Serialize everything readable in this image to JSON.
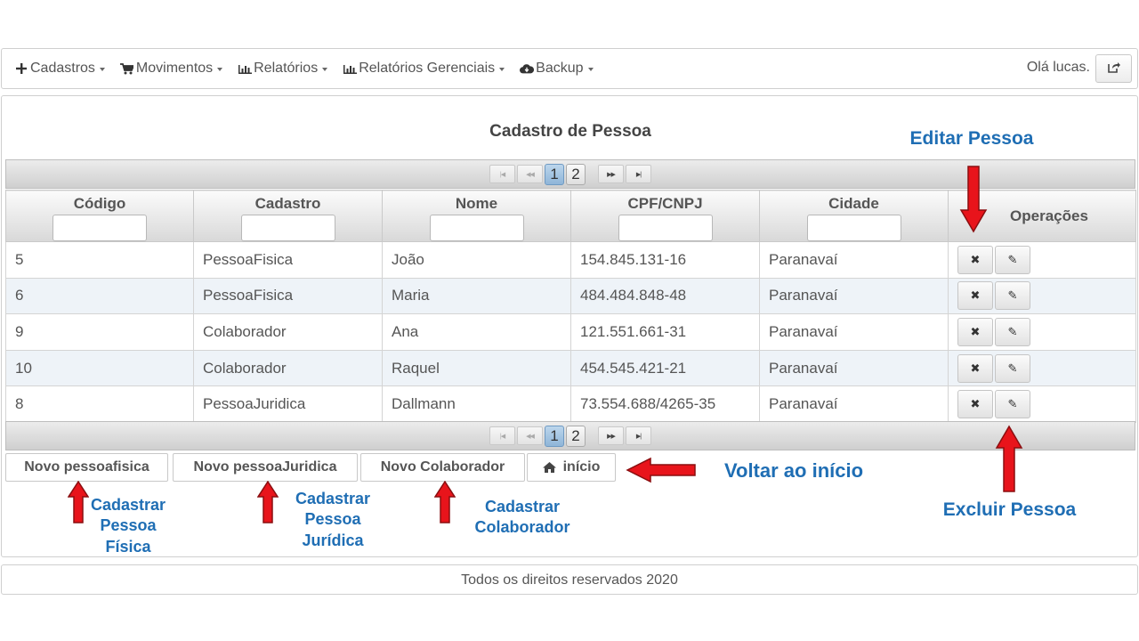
{
  "navbar": {
    "menus": [
      {
        "icon": "plus-icon",
        "label": "Cadastros"
      },
      {
        "icon": "cart-icon",
        "label": "Movimentos"
      },
      {
        "icon": "bar-chart-icon",
        "label": "Relatórios"
      },
      {
        "icon": "bar-chart-icon",
        "label": "Relatórios Gerenciais"
      },
      {
        "icon": "cloud-download-icon",
        "label": "Backup"
      }
    ],
    "greeting": "Olá lucas."
  },
  "page": {
    "title": "Cadastro de Pessoa"
  },
  "paginator": {
    "pages": [
      "1",
      "2"
    ],
    "current_page": "1"
  },
  "table": {
    "columns": [
      "Código",
      "Cadastro",
      "Nome",
      "CPF/CNPJ",
      "Cidade",
      "Operações"
    ],
    "rows": [
      {
        "codigo": "5",
        "cadastro": "PessoaFisica",
        "nome": "João",
        "cpf": "154.845.131-16",
        "cidade": "Paranavaí"
      },
      {
        "codigo": "6",
        "cadastro": "PessoaFisica",
        "nome": "Maria",
        "cpf": "484.484.848-48",
        "cidade": "Paranavaí"
      },
      {
        "codigo": "9",
        "cadastro": "Colaborador",
        "nome": "Ana",
        "cpf": "121.551.661-31",
        "cidade": "Paranavaí"
      },
      {
        "codigo": "10",
        "cadastro": "Colaborador",
        "nome": "Raquel",
        "cpf": "454.545.421-21",
        "cidade": "Paranavaí"
      },
      {
        "codigo": "8",
        "cadastro": "PessoaJuridica",
        "nome": "Dallmann",
        "cpf": "73.554.688/4265-35",
        "cidade": "Paranavaí"
      }
    ]
  },
  "actions": {
    "new_fisica": "Novo pessoafisica",
    "new_juridica": "Novo pessoaJuridica",
    "new_colaborador": "Novo Colaborador",
    "home": "início"
  },
  "annotations": {
    "editar": "Editar Pessoa",
    "excluir": "Excluir Pessoa",
    "voltar": "Voltar ao início",
    "cad_fisica": [
      "Cadastrar",
      "Pessoa",
      "Física"
    ],
    "cad_juridica": [
      "Cadastrar",
      "Pessoa",
      "Jurídica"
    ],
    "cad_colaborador": [
      "Cadastrar",
      "Colaborador"
    ]
  },
  "footer": {
    "text": "Todos os direitos reservados 2020"
  },
  "colors": {
    "annotation": "#1f6eb4",
    "arrow": "#e8141b",
    "active_page": "#9dc0e0"
  }
}
